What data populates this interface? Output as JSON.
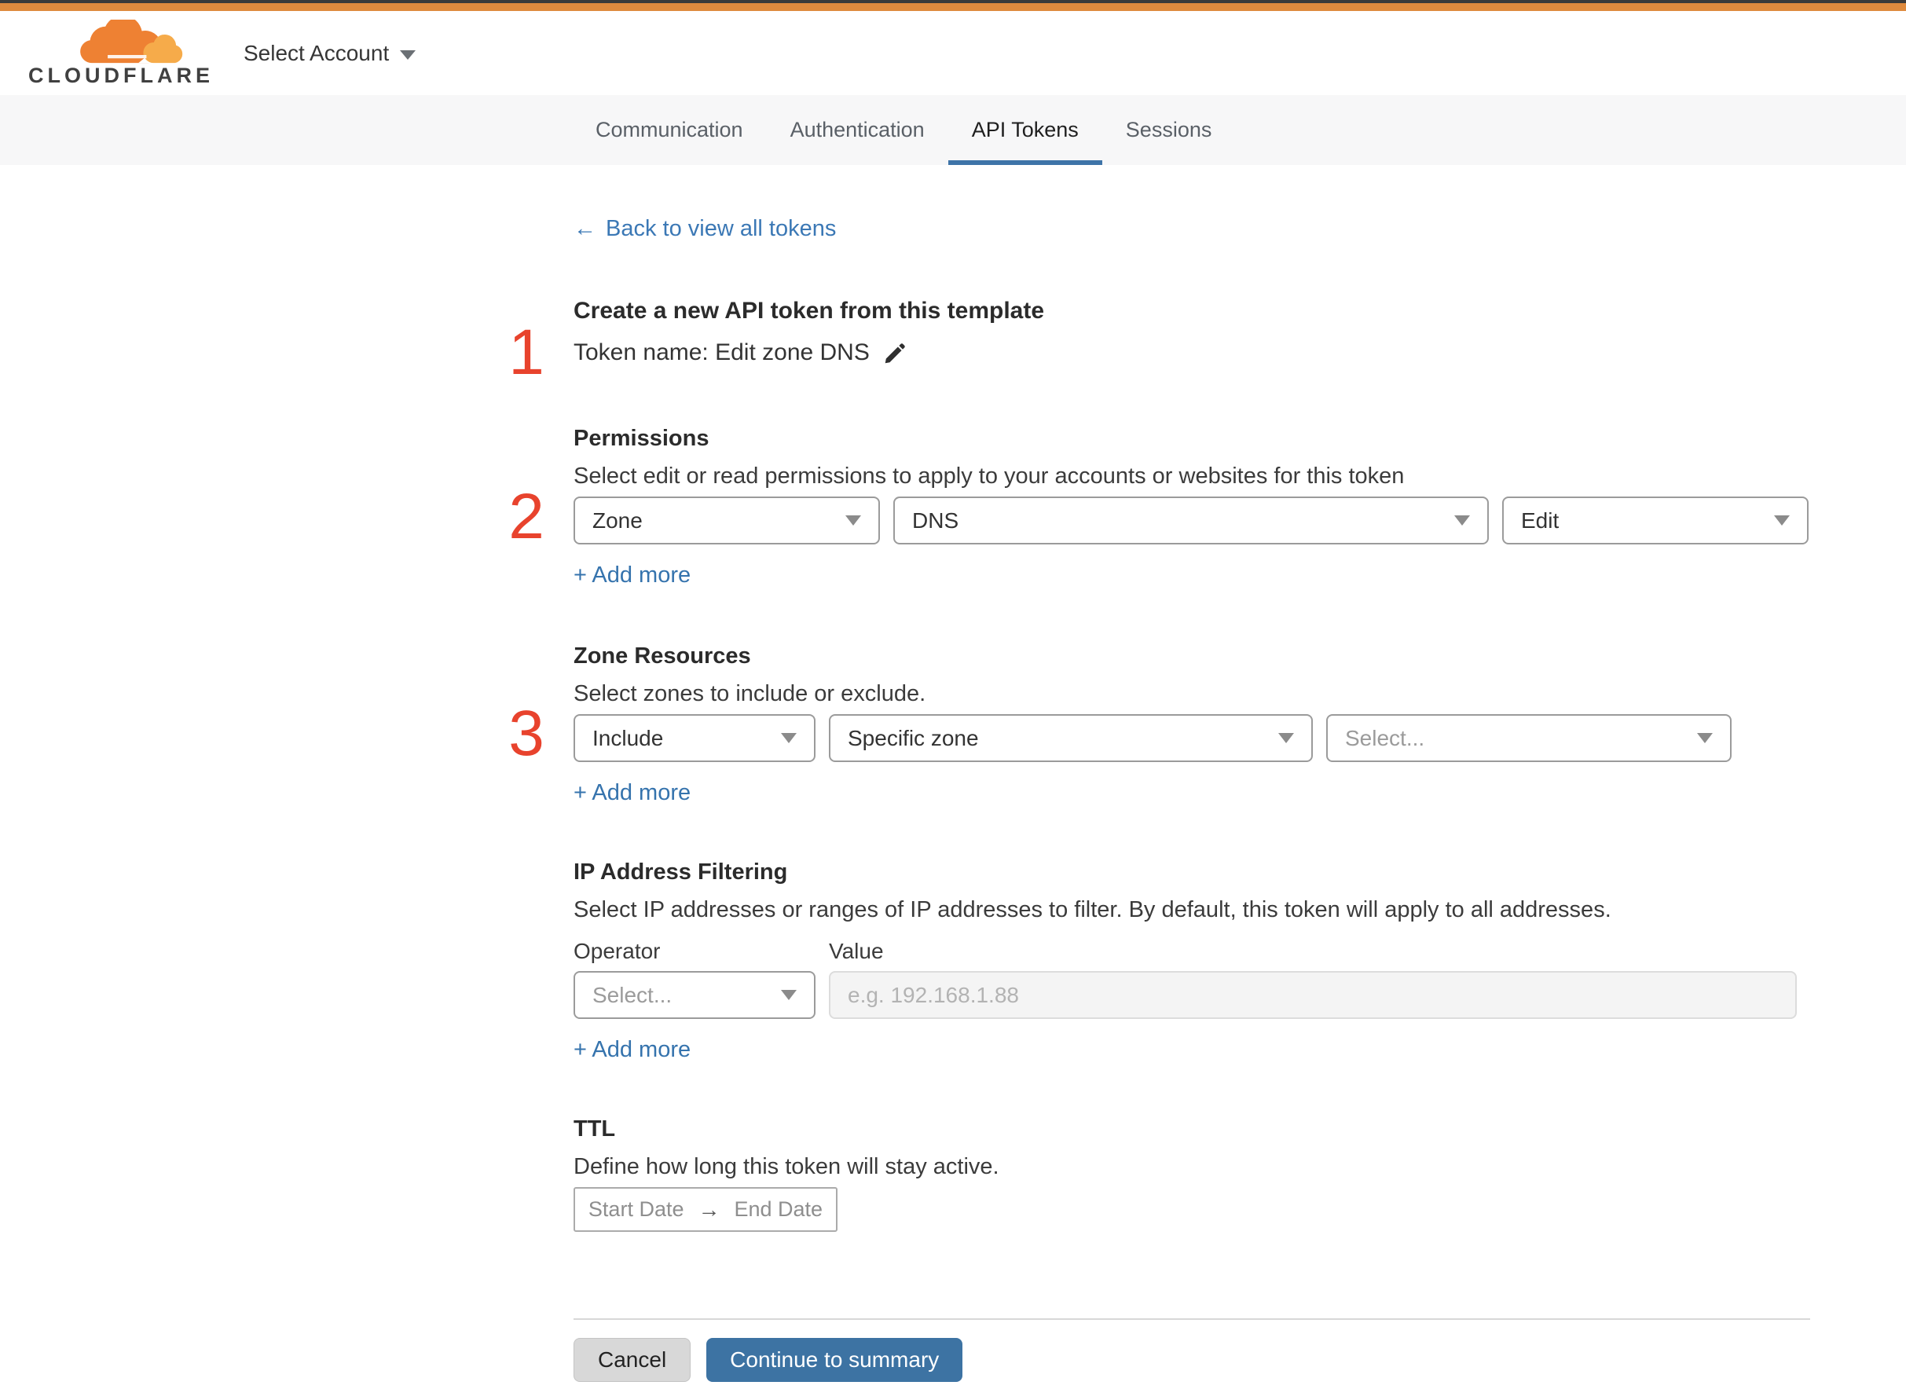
{
  "brand": {
    "name": "CLOUDFLARE",
    "account_selector": "Select Account"
  },
  "tabs": [
    {
      "label": "Communication"
    },
    {
      "label": "Authentication"
    },
    {
      "label": "API Tokens"
    },
    {
      "label": "Sessions"
    }
  ],
  "back_link": {
    "arrow": "←",
    "label": "Back to view all tokens"
  },
  "steps": {
    "one": "1",
    "two": "2",
    "three": "3"
  },
  "template_section": {
    "heading": "Create a new API token from this template",
    "token_name": "Token name: Edit zone DNS"
  },
  "permissions": {
    "heading": "Permissions",
    "description": "Select edit or read permissions to apply to your accounts or websites for this token",
    "selects": [
      {
        "value": "Zone"
      },
      {
        "value": "DNS"
      },
      {
        "value": "Edit"
      }
    ],
    "add_more": "+ Add more"
  },
  "zone_resources": {
    "heading": "Zone Resources",
    "description": "Select zones to include or exclude.",
    "selects": [
      {
        "value": "Include"
      },
      {
        "value": "Specific zone"
      },
      {
        "value": "Select..."
      }
    ],
    "add_more": "+ Add more"
  },
  "ip_filtering": {
    "heading": "IP Address Filtering",
    "description": "Select IP addresses or ranges of IP addresses to filter. By default, this token will apply to all addresses.",
    "operator_label": "Operator",
    "value_label": "Value",
    "operator_placeholder": "Select...",
    "value_placeholder": "e.g. 192.168.1.88",
    "add_more": "+ Add more"
  },
  "ttl": {
    "heading": "TTL",
    "description": "Define how long this token will stay active.",
    "start_label": "Start Date",
    "arrow": "→",
    "end_label": "End Date"
  },
  "footer": {
    "cancel": "Cancel",
    "continue": "Continue to summary"
  },
  "colors": {
    "top_bar_orange": "#de8a3e",
    "step_number_red": "#e8432d",
    "link_blue": "#3b78b5",
    "accent_blue": "#3d73a3",
    "tab_bar_bg": "#f7f7f8"
  }
}
